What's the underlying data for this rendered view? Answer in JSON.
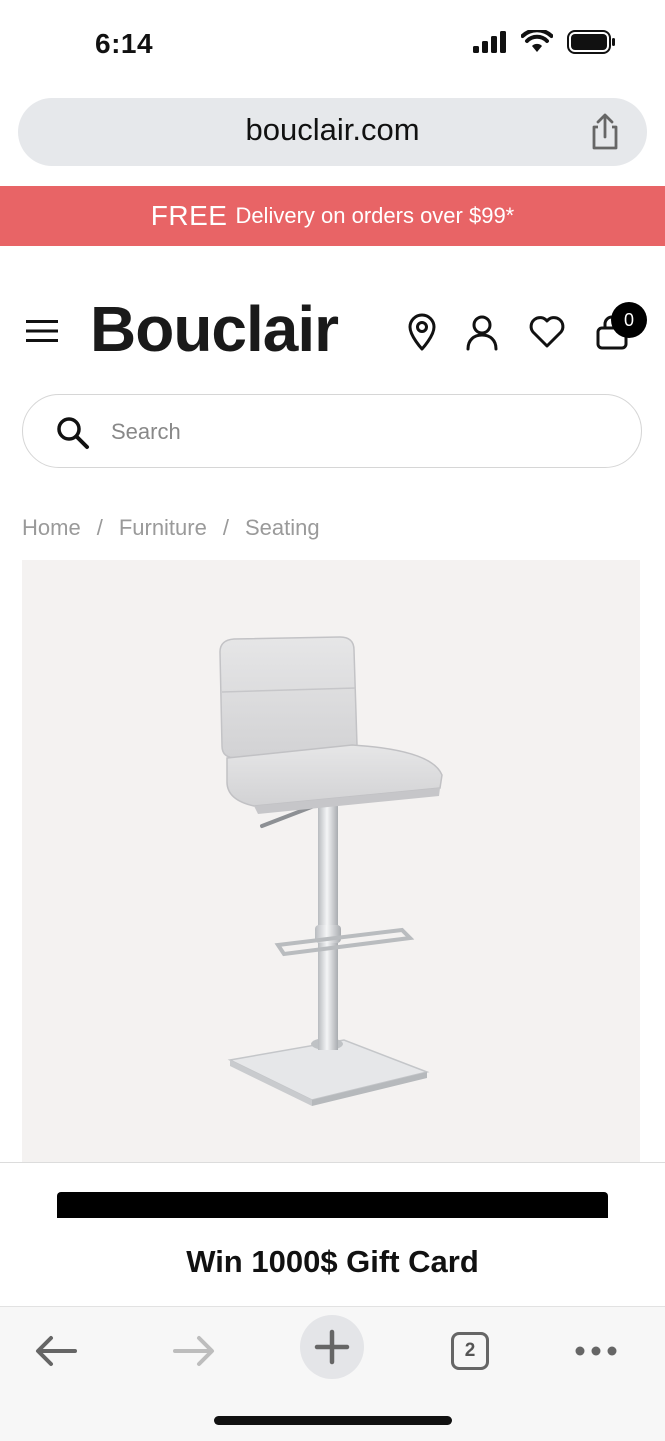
{
  "status": {
    "time": "6:14"
  },
  "browser": {
    "url": "bouclair.com",
    "tabs_count": "2"
  },
  "promo": {
    "strong": "FREE",
    "rest": "Delivery on orders over $99*",
    "color": "#e86466"
  },
  "header": {
    "logo": "Bouclair",
    "cart_count": "0"
  },
  "search": {
    "placeholder": "Search",
    "value": ""
  },
  "breadcrumb": {
    "items": [
      "Home",
      "Furniture",
      "Seating"
    ],
    "separator": "/"
  },
  "gift": {
    "label": "Win 1000$ Gift Card"
  },
  "icons": {
    "menu": "hamburger-icon",
    "location": "location-pin-icon",
    "account": "user-icon",
    "wishlist": "heart-icon",
    "cart": "shopping-bag-icon",
    "search": "search-icon",
    "share": "share-icon",
    "back": "arrow-left-icon",
    "forward": "arrow-right-icon",
    "new_tab": "plus-icon",
    "tabs": "tabs-icon",
    "more": "more-icon"
  }
}
